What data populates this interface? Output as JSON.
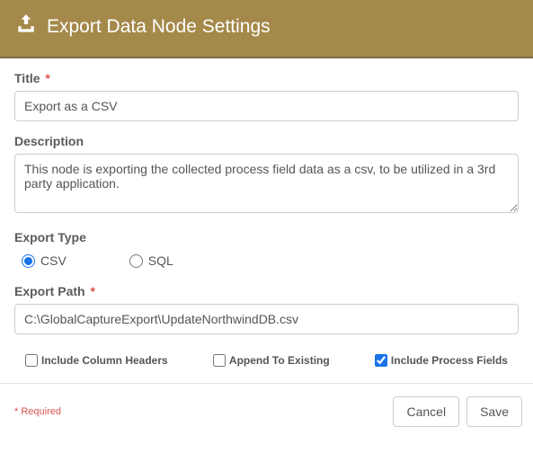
{
  "header": {
    "title": "Export Data Node Settings"
  },
  "fields": {
    "title_label": "Title",
    "title_value": "Export as a CSV",
    "description_label": "Description",
    "description_value": "This node is exporting the collected process field data as a csv, to be utilized in a 3rd party application.",
    "export_type_label": "Export Type",
    "export_type_csv": "CSV",
    "export_type_sql": "SQL",
    "export_path_label": "Export Path",
    "export_path_value": "C:\\GlobalCaptureExport\\UpdateNorthwindDB.csv",
    "chk_headers": "Include Column Headers",
    "chk_append": "Append To Existing",
    "chk_process": "Include Process Fields"
  },
  "footer": {
    "required_note": "* Required",
    "cancel": "Cancel",
    "save": "Save"
  },
  "required_marker": "*"
}
